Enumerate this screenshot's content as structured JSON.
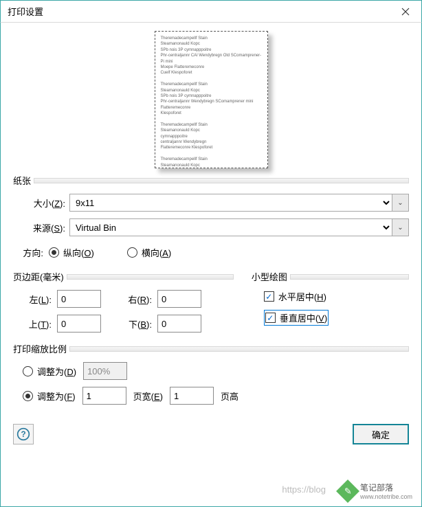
{
  "window": {
    "title": "打印设置"
  },
  "preview_text": "Theremadecampellf Stain\nSteamanonauld Kopc\nSPb nois 3P cymnapppoitre\nPhr-centraljannr CAl Wendybregn Old SComamprener-Pi mini\nMoepe Flatteremeconre\nCuelf Klespoforet\n\nTheremadecampellf Stain\nSteamanonauld Kopc\nSPb nois 3P cymnapppoitre\nPhr-centraljannr Wendybregn SComamprener mini\nFlatteremeconre\nKlespoforet\n\nTheremadecampellf Stain\nSteamanonauld Kopc\ncymnapppoitre\ncentraljannr Wendybregn\nFlatteremeconre Klespoforet\n\nTheremadecampellf Stain\nSteamanonauld Kopc\ncymnapppoitre Wendybregn\nPhr centraljannr Wendybregn SComamprener mini\n\nTheremadecampellf Stain\nSteamanonauld Kopc\ncymnapppoitre\ncentraljannr Wendybregn SComamprener mini",
  "paper": {
    "group_label": "纸张",
    "size_label": "大小(Z):",
    "size_value": "9x11",
    "source_label": "来源(S):",
    "source_value": "Virtual Bin"
  },
  "orientation": {
    "label": "方向:",
    "portrait": "纵向(O)",
    "landscape": "横向(A)",
    "selected": "portrait"
  },
  "margins": {
    "group_label": "页边距(毫米)",
    "left_label": "左(L):",
    "left_value": "0",
    "right_label": "右(R):",
    "right_value": "0",
    "top_label": "上(T):",
    "top_value": "0",
    "bottom_label": "下(B):",
    "bottom_value": "0"
  },
  "miniplot": {
    "group_label": "小型绘图",
    "center_h": "水平居中(H)",
    "center_v": "垂直居中(V)",
    "h_checked": true,
    "v_checked": true
  },
  "scale": {
    "group_label": "打印缩放比例",
    "adjust_pct_label": "调整为(D)",
    "adjust_pct_value": "100%",
    "adjust_fit_label": "调整为(F)",
    "fit_wide_value": "1",
    "fit_wide_label": "页宽(E)",
    "fit_tall_value": "1",
    "fit_tall_label": "页高",
    "selected": "fit"
  },
  "buttons": {
    "ok": "确定"
  },
  "watermark": {
    "behind": "https://blog",
    "name": "笔记部落",
    "url": "www.notetribe.com"
  }
}
